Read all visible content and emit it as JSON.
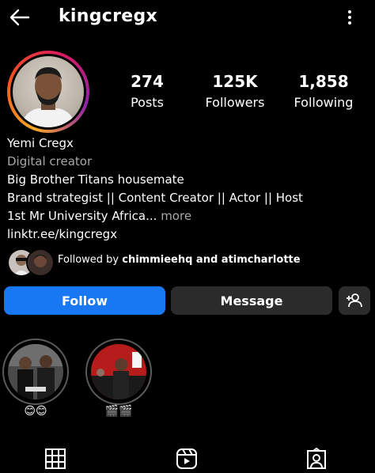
{
  "header": {
    "username": "kingcregx"
  },
  "stats": [
    {
      "value": "274",
      "label": "Posts"
    },
    {
      "value": "125K",
      "label": "Followers"
    },
    {
      "value": "1,858",
      "label": "Following"
    }
  ],
  "bio": {
    "name": "Yemi Cregx",
    "category": "Digital creator",
    "line1": "Big Brother Titans housemate",
    "line2": "Brand strategist || Content Creator || Actor || Host",
    "line3": "1st Mr University Africa...",
    "more": "more",
    "link": "linktr.ee/kingcregx"
  },
  "followed_by": {
    "prefix": "Followed by ",
    "users": "chimmieehq and atimcharlotte"
  },
  "actions": {
    "follow": "Follow",
    "message": "Message"
  },
  "highlights": [
    {
      "label": "😊😊"
    },
    {
      "label": "🎬🎬"
    }
  ],
  "colors": {
    "follow_button": "#1877f2",
    "secondary_button": "#2b2b2b",
    "background": "#000000"
  }
}
